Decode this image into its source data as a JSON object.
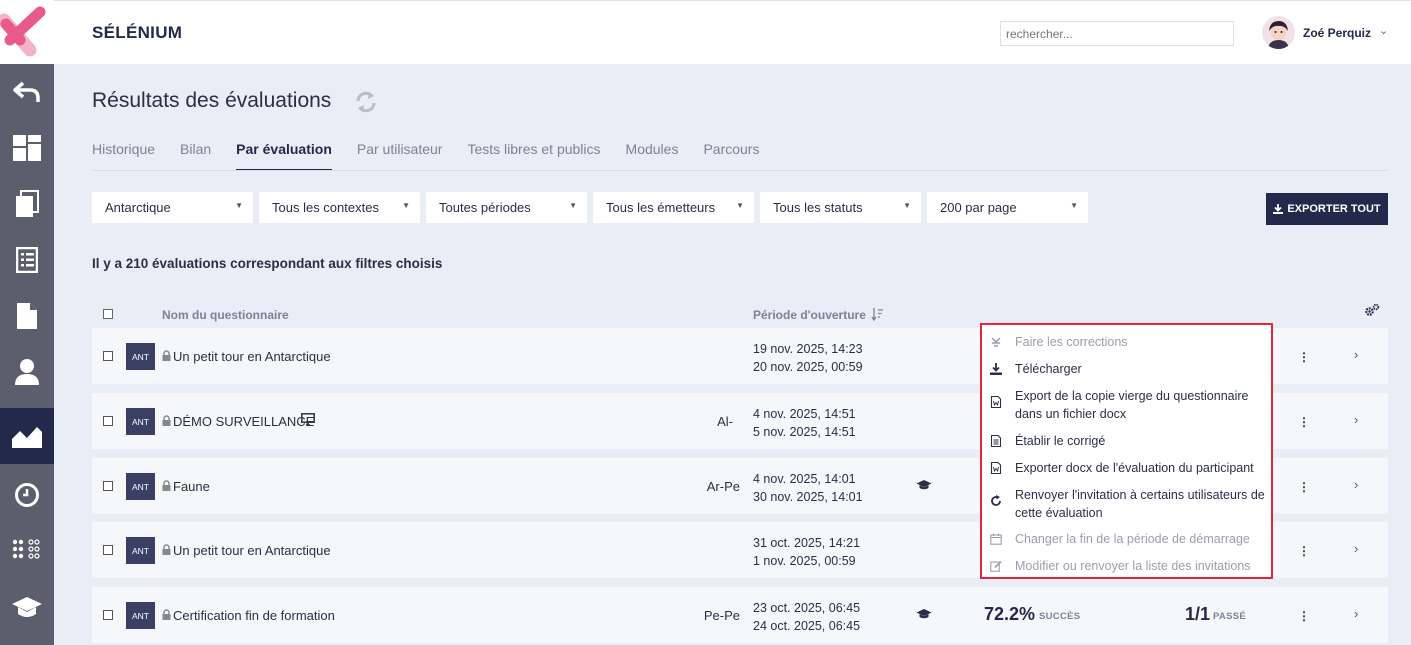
{
  "app": {
    "brand": "SÉLÉNIUM"
  },
  "search": {
    "placeholder": "rechercher..."
  },
  "user": {
    "name": "Zoé Perquiz"
  },
  "page": {
    "title": "Résultats des évaluations"
  },
  "tabs": [
    {
      "label": "Historique",
      "active": false
    },
    {
      "label": "Bilan",
      "active": false
    },
    {
      "label": "Par évaluation",
      "active": true
    },
    {
      "label": "Par utilisateur",
      "active": false
    },
    {
      "label": "Tests libres et publics",
      "active": false
    },
    {
      "label": "Modules",
      "active": false
    },
    {
      "label": "Parcours",
      "active": false
    }
  ],
  "filters": [
    "Antarctique",
    "Tous les contextes",
    "Toutes périodes",
    "Tous les émetteurs",
    "Tous les statuts",
    "200 par page"
  ],
  "export_all": {
    "label": "EXPORTER TOUT"
  },
  "result_count": "Il y a 210 évaluations correspondant aux filtres choisis",
  "table": {
    "headers": {
      "name": "Nom du questionnaire",
      "period": "Période d'ouverture"
    },
    "rows": [
      {
        "tag": "ANT",
        "name": "Un petit tour en Antarctique",
        "code": "",
        "start": "19 nov. 2025, 14:23",
        "end": "20 nov. 2025, 00:59",
        "monitor": false,
        "hat": false,
        "success": "",
        "success_label": "",
        "score": "",
        "score_label": ""
      },
      {
        "tag": "ANT",
        "name": "DÉMO SURVEILLANCE",
        "code": "Al-",
        "start": "4 nov. 2025, 14:51",
        "end": "5 nov. 2025, 14:51",
        "monitor": true,
        "hat": false,
        "success": "",
        "success_label": "",
        "score": "",
        "score_label": ""
      },
      {
        "tag": "ANT",
        "name": "Faune",
        "code": "Ar-Pe",
        "start": "4 nov. 2025, 14:01",
        "end": "30 nov. 2025, 14:01",
        "monitor": false,
        "hat": true,
        "success": "",
        "success_label": "",
        "score": "",
        "score_label": ""
      },
      {
        "tag": "ANT",
        "name": "Un petit tour en Antarctique",
        "code": "",
        "start": "31 oct. 2025, 14:21",
        "end": "1 nov. 2025, 00:59",
        "monitor": false,
        "hat": false,
        "success": "",
        "success_label": "",
        "score": "",
        "score_label": ""
      },
      {
        "tag": "ANT",
        "name": "Certification fin de formation",
        "code": "Pe-Pe",
        "start": "23 oct. 2025, 06:45",
        "end": "24 oct. 2025, 06:45",
        "monitor": false,
        "hat": true,
        "success": "72.2%",
        "success_label": "SUCCÈS",
        "score": "1/1",
        "score_label": "PASSÉ"
      }
    ]
  },
  "context_menu": {
    "items": [
      {
        "label": "Faire les corrections",
        "icon": "corrections-icon",
        "disabled": true
      },
      {
        "label": "Télécharger",
        "icon": "download-icon",
        "disabled": false
      },
      {
        "label": "Export de la copie vierge du questionnaire dans un fichier docx",
        "icon": "word-file-icon",
        "disabled": false
      },
      {
        "label": "Établir le corrigé",
        "icon": "document-icon",
        "disabled": false
      },
      {
        "label": "Exporter docx de l'évaluation du participant",
        "icon": "word-file-icon",
        "disabled": false
      },
      {
        "label": "Renvoyer l'invitation à certains utilisateurs de cette évaluation",
        "icon": "resend-icon",
        "disabled": false
      },
      {
        "label": "Changer la fin de la période de démarrage",
        "icon": "calendar-icon",
        "disabled": true
      },
      {
        "label": "Modifier ou renvoyer la liste des invitations",
        "icon": "edit-icon",
        "disabled": true
      }
    ]
  }
}
